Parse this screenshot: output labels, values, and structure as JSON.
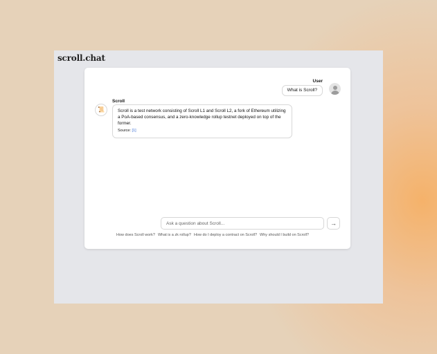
{
  "app": {
    "logo": "scroll.chat"
  },
  "conversation": {
    "user": {
      "name": "User",
      "message": "What is Scroll?",
      "avatar_icon": "user-avatar-icon"
    },
    "bot": {
      "name": "Scroll",
      "avatar_icon": "scroll-icon",
      "message": "Scroll is a test network consisting of Scroll L1 and Scroll L2, a fork of Ethereum utilizing a PoA-based consensus, and a zero-knowledge rollup testnet deployed on top of the former.",
      "source_label": "Source:",
      "source_link": "[1]"
    }
  },
  "input": {
    "placeholder": "Ask a question about Scroll...",
    "value": ""
  },
  "send_button": {
    "icon": "arrow-right-icon",
    "glyph": "→"
  },
  "suggestions": [
    "How does Scroll work?",
    "What is a zk rollup?",
    "How do I deploy a contract on Scroll?",
    "Why should I build on Scroll?"
  ],
  "colors": {
    "link": "#3b6fd6",
    "app_bg": "#e5e6ea",
    "card_bg": "#ffffff"
  }
}
